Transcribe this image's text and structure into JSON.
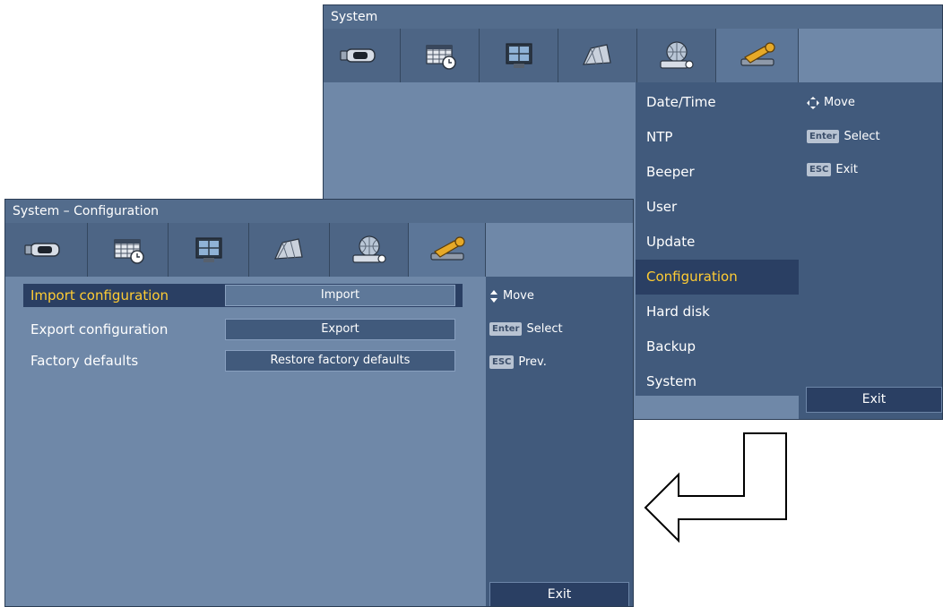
{
  "system_window": {
    "title": "System",
    "tabs": [
      {
        "icon": "camera-icon"
      },
      {
        "icon": "schedule-icon"
      },
      {
        "icon": "monitor-icon"
      },
      {
        "icon": "event-icon"
      },
      {
        "icon": "network-icon"
      },
      {
        "icon": "tools-icon",
        "active": true
      }
    ],
    "menu_items": [
      "Date/Time",
      "NTP",
      "Beeper",
      "User",
      "Update",
      "Configuration",
      "Hard disk",
      "Backup",
      "System"
    ],
    "selected_menu_item": "Configuration",
    "hints": {
      "move": "Move",
      "enter_key": "Enter",
      "select": "Select",
      "esc_key": "ESC",
      "exit": "Exit"
    },
    "exit_button": "Exit"
  },
  "config_window": {
    "title": "System – Configuration",
    "tabs": [
      {
        "icon": "camera-icon"
      },
      {
        "icon": "schedule-icon"
      },
      {
        "icon": "monitor-icon"
      },
      {
        "icon": "event-icon"
      },
      {
        "icon": "network-icon"
      },
      {
        "icon": "tools-icon",
        "active": true
      }
    ],
    "rows": [
      {
        "label": "Import configuration",
        "button": "Import",
        "selected": true
      },
      {
        "label": "Export configuration",
        "button": "Export"
      },
      {
        "label": "Factory defaults",
        "button": "Restore factory defaults"
      }
    ],
    "hints": {
      "move": "Move",
      "enter_key": "Enter",
      "select": "Select",
      "esc_key": "ESC",
      "prev": "Prev."
    },
    "exit_button": "Exit"
  },
  "colors": {
    "window_bg": "#6f88a8",
    "panel_bg": "#415a7c",
    "selected_bg": "#2a3f63",
    "selected_text": "#ffcc33"
  }
}
